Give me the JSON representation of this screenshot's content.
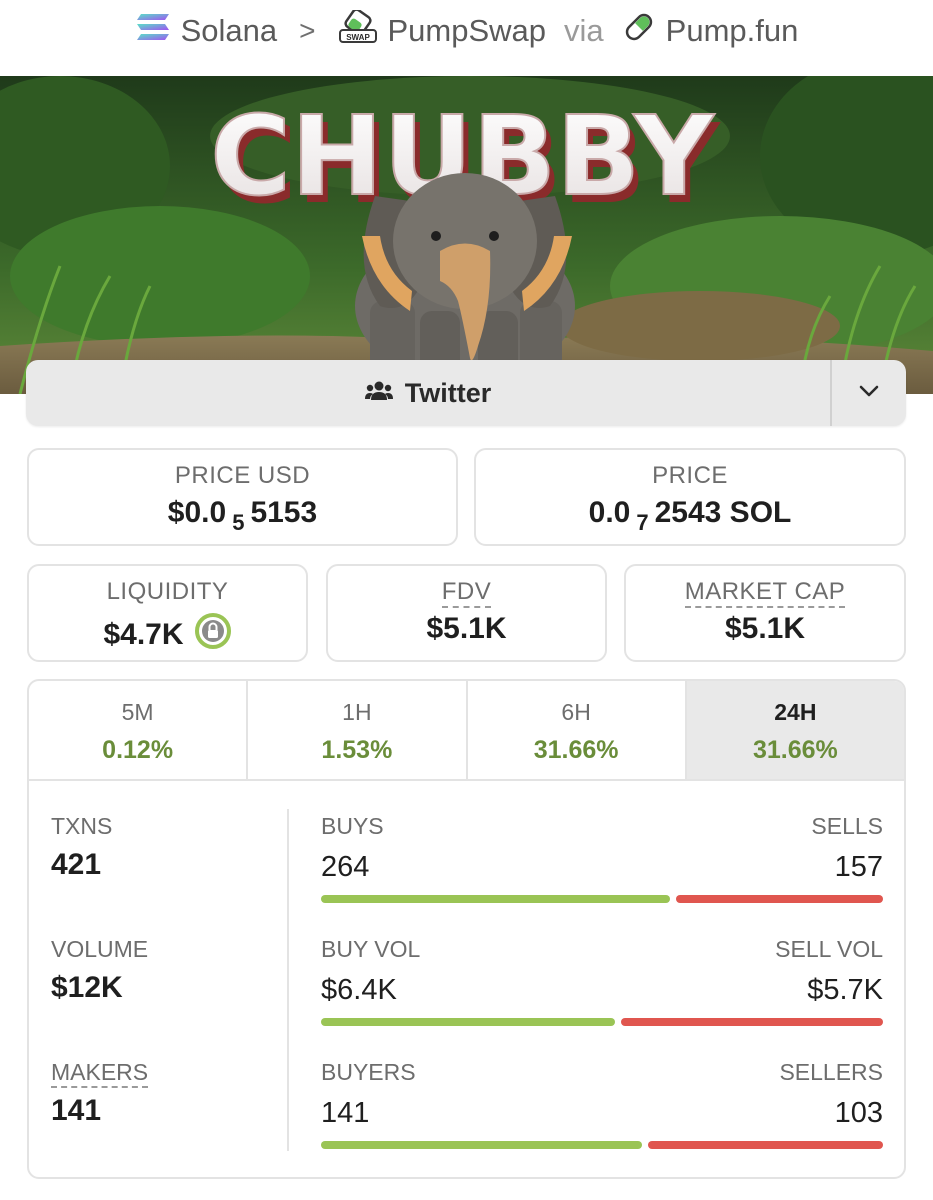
{
  "breadcrumb": {
    "chain": "Solana",
    "separator": ">",
    "dex": "PumpSwap",
    "dex_icon_text": "SWAP",
    "via": "via",
    "launchpad": "Pump.fun"
  },
  "banner": {
    "title_text": "CHUBBY"
  },
  "social": {
    "label": "Twitter"
  },
  "price_usd": {
    "label": "PRICE USD",
    "prefix": "$0.0",
    "zeros": "5",
    "digits": "5153"
  },
  "price_native": {
    "label": "PRICE",
    "prefix": "0.0",
    "zeros": "7",
    "digits": "2543 SOL"
  },
  "liquidity": {
    "label": "LIQUIDITY",
    "value": "$4.7K"
  },
  "fdv": {
    "label": "FDV",
    "value": "$5.1K"
  },
  "market_cap": {
    "label": "MARKET CAP",
    "value": "$5.1K"
  },
  "tabs": [
    {
      "label": "5M",
      "value": "0.12%"
    },
    {
      "label": "1H",
      "value": "1.53%"
    },
    {
      "label": "6H",
      "value": "31.66%"
    },
    {
      "label": "24H",
      "value": "31.66%",
      "active": true
    }
  ],
  "stats": {
    "txns": {
      "label": "TXNS",
      "value": "421"
    },
    "volume": {
      "label": "VOLUME",
      "value": "$12K"
    },
    "makers": {
      "label": "MAKERS",
      "value": "141"
    },
    "buys": {
      "label": "BUYS",
      "value": "264",
      "share": 0.627
    },
    "sells": {
      "label": "SELLS",
      "value": "157"
    },
    "buy_vol": {
      "label": "BUY VOL",
      "value": "$6.4K",
      "share": 0.529
    },
    "sell_vol": {
      "label": "SELL VOL",
      "value": "$5.7K"
    },
    "buyers": {
      "label": "BUYERS",
      "value": "141",
      "share": 0.578
    },
    "sellers": {
      "label": "SELLERS",
      "value": "103"
    }
  },
  "colors": {
    "positive": "#6a8d3a",
    "buy_bar": "#9ac455",
    "sell_bar": "#e0564f"
  }
}
